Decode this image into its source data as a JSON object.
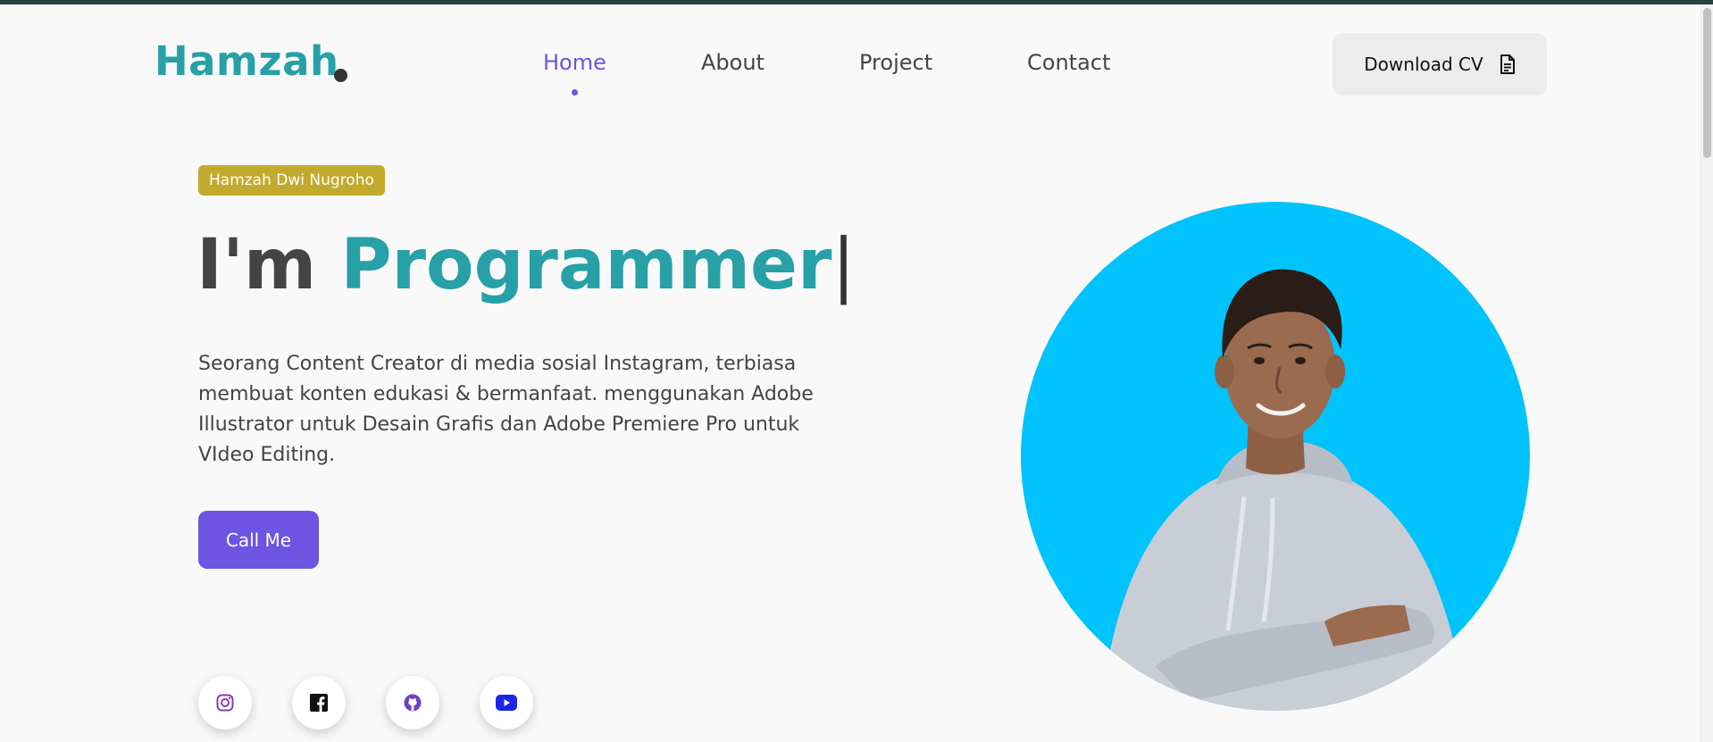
{
  "brand": {
    "logo_text": "Hamzah"
  },
  "nav": {
    "items": [
      {
        "label": "Home",
        "active": true
      },
      {
        "label": "About",
        "active": false
      },
      {
        "label": "Project",
        "active": false
      },
      {
        "label": "Contact",
        "active": false
      }
    ],
    "active_color": "#6d54e3"
  },
  "header": {
    "cv_button_label": "Download CV",
    "cv_icon": "document-icon"
  },
  "hero": {
    "badge": "Hamzah Dwi Nugroho",
    "headline_prefix": "I'm",
    "headline_role": "Programmer",
    "caret": "|",
    "description": "Seorang Content Creator di media sosial Instagram, terbiasa membuat konten edukasi & bermanfaat. menggunakan Adobe Illustrator untuk Desain Grafis dan Adobe Premiere Pro untuk VIdeo Editing.",
    "cta_label": "Call Me"
  },
  "social": [
    {
      "name": "instagram-icon",
      "color": "#8a3ab9"
    },
    {
      "name": "facebook-icon",
      "color": "#111111"
    },
    {
      "name": "github-icon",
      "color": "#6f42c1"
    },
    {
      "name": "youtube-icon",
      "color": "#1a27e6"
    }
  ],
  "colors": {
    "brand": "#27a0a8",
    "accent": "#6d54e3",
    "badge": "#c2aa2d",
    "portrait_bg": "#00c3fb",
    "background": "#f9f9f9"
  }
}
